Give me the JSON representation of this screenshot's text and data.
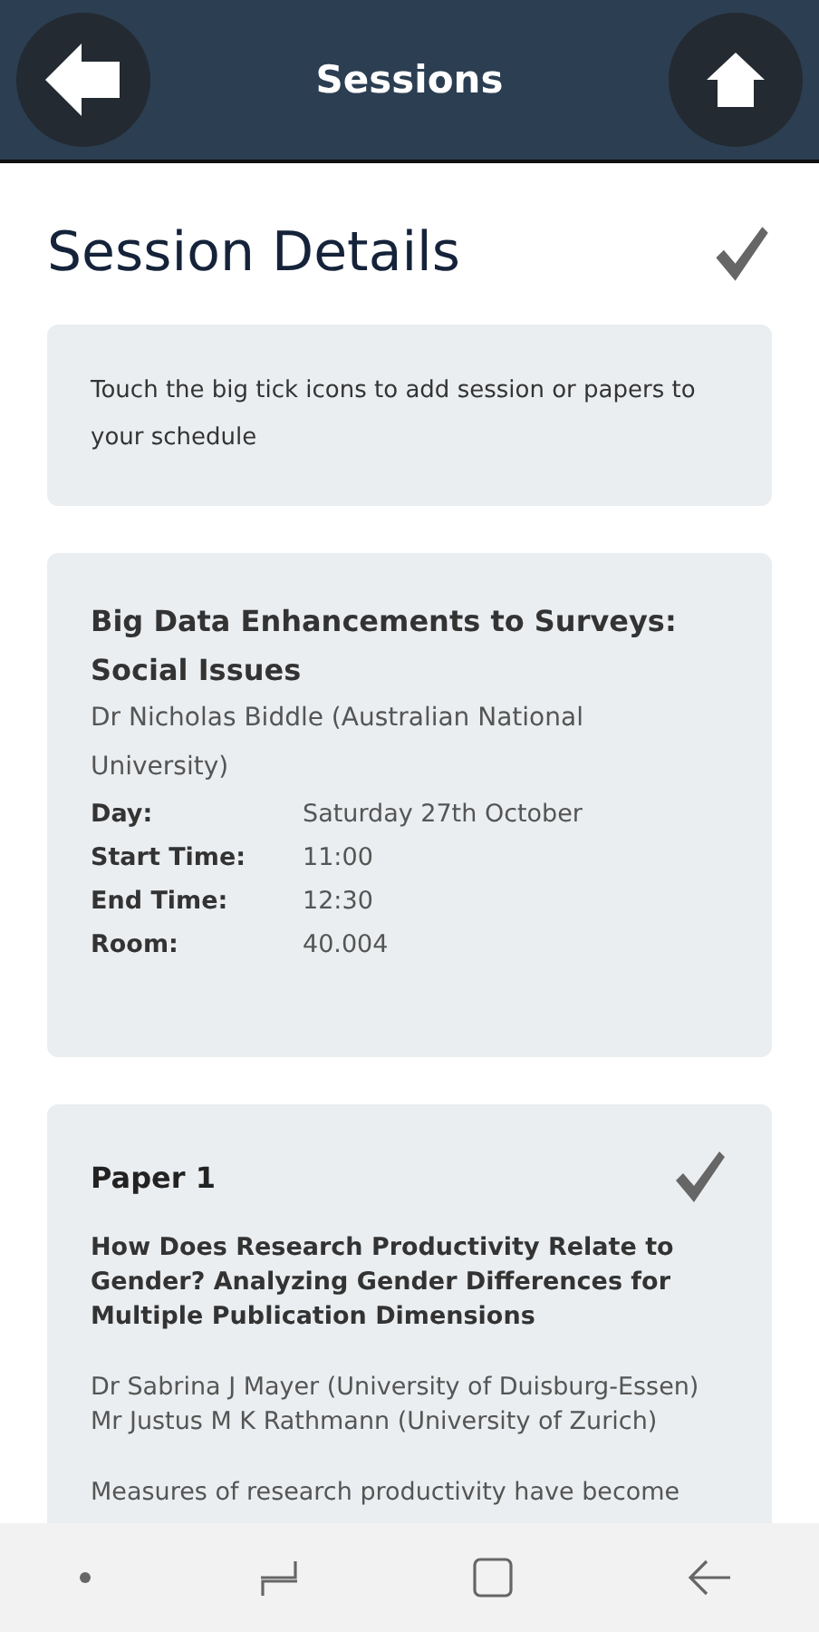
{
  "header": {
    "title": "Sessions"
  },
  "page_title": "Session Details",
  "hint": "Touch the big tick icons to add session or papers to your schedule",
  "session": {
    "title": "Big Data Enhancements to Surveys: Social Issues",
    "presenter": "Dr Nicholas Biddle (Australian National University)",
    "details": [
      {
        "label": "Day:",
        "value": "Saturday 27th October"
      },
      {
        "label": "Start Time:",
        "value": "11:00"
      },
      {
        "label": "End Time:",
        "value": "12:30"
      },
      {
        "label": "Room:",
        "value": "40.004"
      }
    ]
  },
  "papers": [
    {
      "heading": "Paper 1",
      "title": "How Does Research Productivity Relate to Gender? Analyzing Gender Differences for Multiple Publication Dimensions",
      "authors": [
        "Dr Sabrina J Mayer (University of Duisburg-Essen)",
        "Mr Justus M K Rathmann (University of Zurich)"
      ],
      "abstract": "Measures of research productivity have become"
    }
  ]
}
